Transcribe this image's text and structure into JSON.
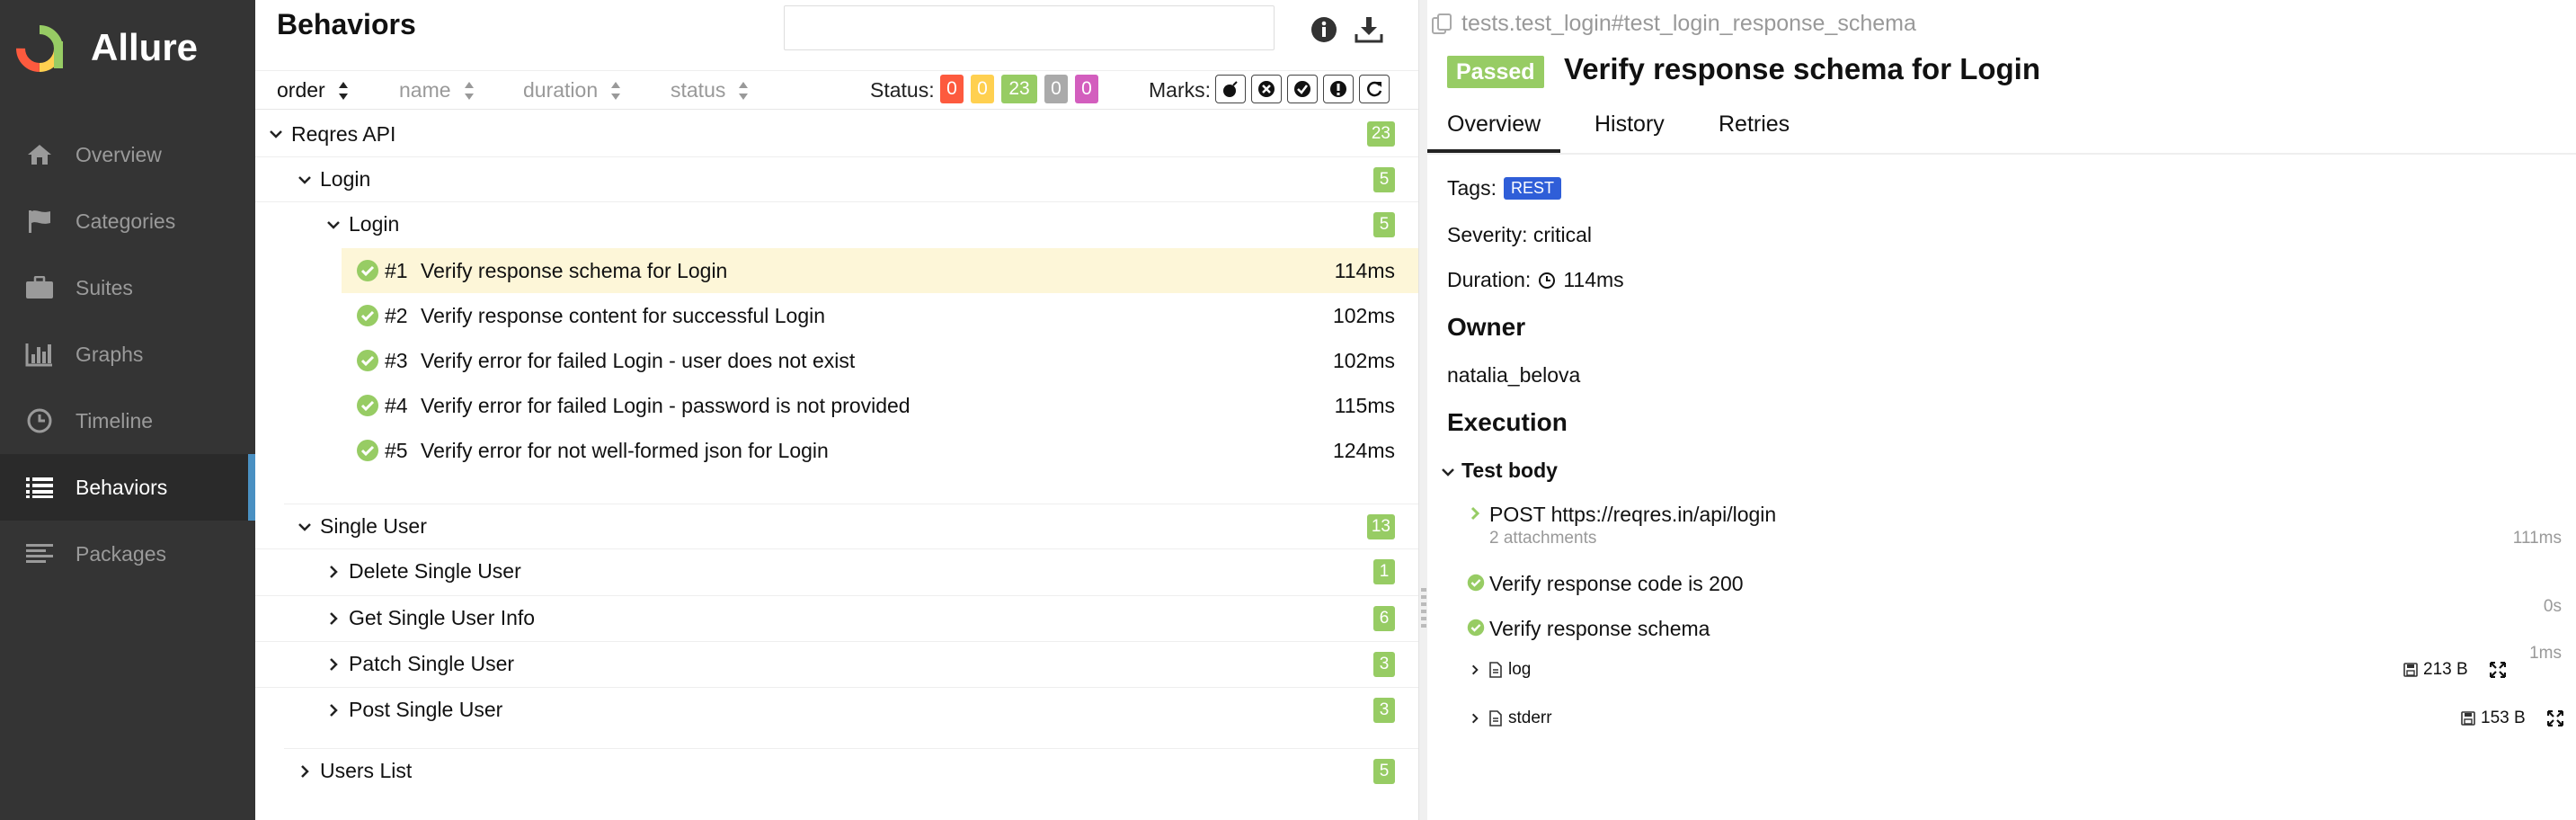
{
  "app": {
    "title": "Allure"
  },
  "sidebar": {
    "items": [
      {
        "label": "Overview",
        "icon": "home-icon"
      },
      {
        "label": "Categories",
        "icon": "flag-icon"
      },
      {
        "label": "Suites",
        "icon": "briefcase-icon"
      },
      {
        "label": "Graphs",
        "icon": "bar-chart-icon"
      },
      {
        "label": "Timeline",
        "icon": "clock-icon"
      },
      {
        "label": "Behaviors",
        "icon": "list-icon",
        "active": true
      },
      {
        "label": "Packages",
        "icon": "align-left-icon"
      }
    ]
  },
  "behaviors": {
    "title": "Behaviors",
    "search_placeholder": "",
    "sort": {
      "order": "order",
      "name": "name",
      "duration": "duration",
      "status": "status"
    },
    "status_label": "Status:",
    "status_counts": [
      {
        "value": "0",
        "color": "#fd5a3e"
      },
      {
        "value": "0",
        "color": "#ffd050"
      },
      {
        "value": "23",
        "color": "#97cc64"
      },
      {
        "value": "0",
        "color": "#aaaaaa"
      },
      {
        "value": "0",
        "color": "#d35ebe"
      }
    ],
    "marks_label": "Marks:",
    "tree": {
      "epic": {
        "label": "Reqres API",
        "count": "23"
      },
      "feature_login": {
        "label": "Login",
        "count": "5"
      },
      "story_login": {
        "label": "Login",
        "count": "5"
      },
      "tests": [
        {
          "num": "#1",
          "name": "Verify response schema for Login",
          "duration": "114ms"
        },
        {
          "num": "#2",
          "name": "Verify response content for successful Login",
          "duration": "102ms"
        },
        {
          "num": "#3",
          "name": "Verify error for failed Login - user does not exist",
          "duration": "102ms"
        },
        {
          "num": "#4",
          "name": "Verify error for failed Login - password is not provided",
          "duration": "115ms"
        },
        {
          "num": "#5",
          "name": "Verify error for not well-formed json for Login",
          "duration": "124ms"
        }
      ],
      "feature_single_user": {
        "label": "Single User",
        "count": "13"
      },
      "stories_single_user": [
        {
          "label": "Delete Single User",
          "count": "1"
        },
        {
          "label": "Get Single User Info",
          "count": "6"
        },
        {
          "label": "Patch Single User",
          "count": "3"
        },
        {
          "label": "Post Single User",
          "count": "3"
        }
      ],
      "feature_users_list": {
        "label": "Users List",
        "count": "5"
      }
    }
  },
  "detail": {
    "path": "tests.test_login#test_login_response_schema",
    "status": "Passed",
    "title": "Verify response schema for Login",
    "tabs": [
      "Overview",
      "History",
      "Retries"
    ],
    "tags_label": "Tags:",
    "tag": "REST",
    "severity": "Severity: critical",
    "duration_label": "Duration:",
    "duration": "114ms",
    "owner_heading": "Owner",
    "owner": "natalia_belova",
    "execution_heading": "Execution",
    "test_body": "Test body",
    "steps": [
      {
        "title": "POST https://reqres.in/api/login",
        "sub": "2 attachments",
        "time": "111ms"
      },
      {
        "title": "Verify response code is 200",
        "time": "0s"
      },
      {
        "title": "Verify response schema",
        "time": "1ms"
      }
    ],
    "attachments": [
      {
        "name": "log",
        "size": "213 B"
      },
      {
        "name": "stderr",
        "size": "153 B"
      }
    ]
  }
}
